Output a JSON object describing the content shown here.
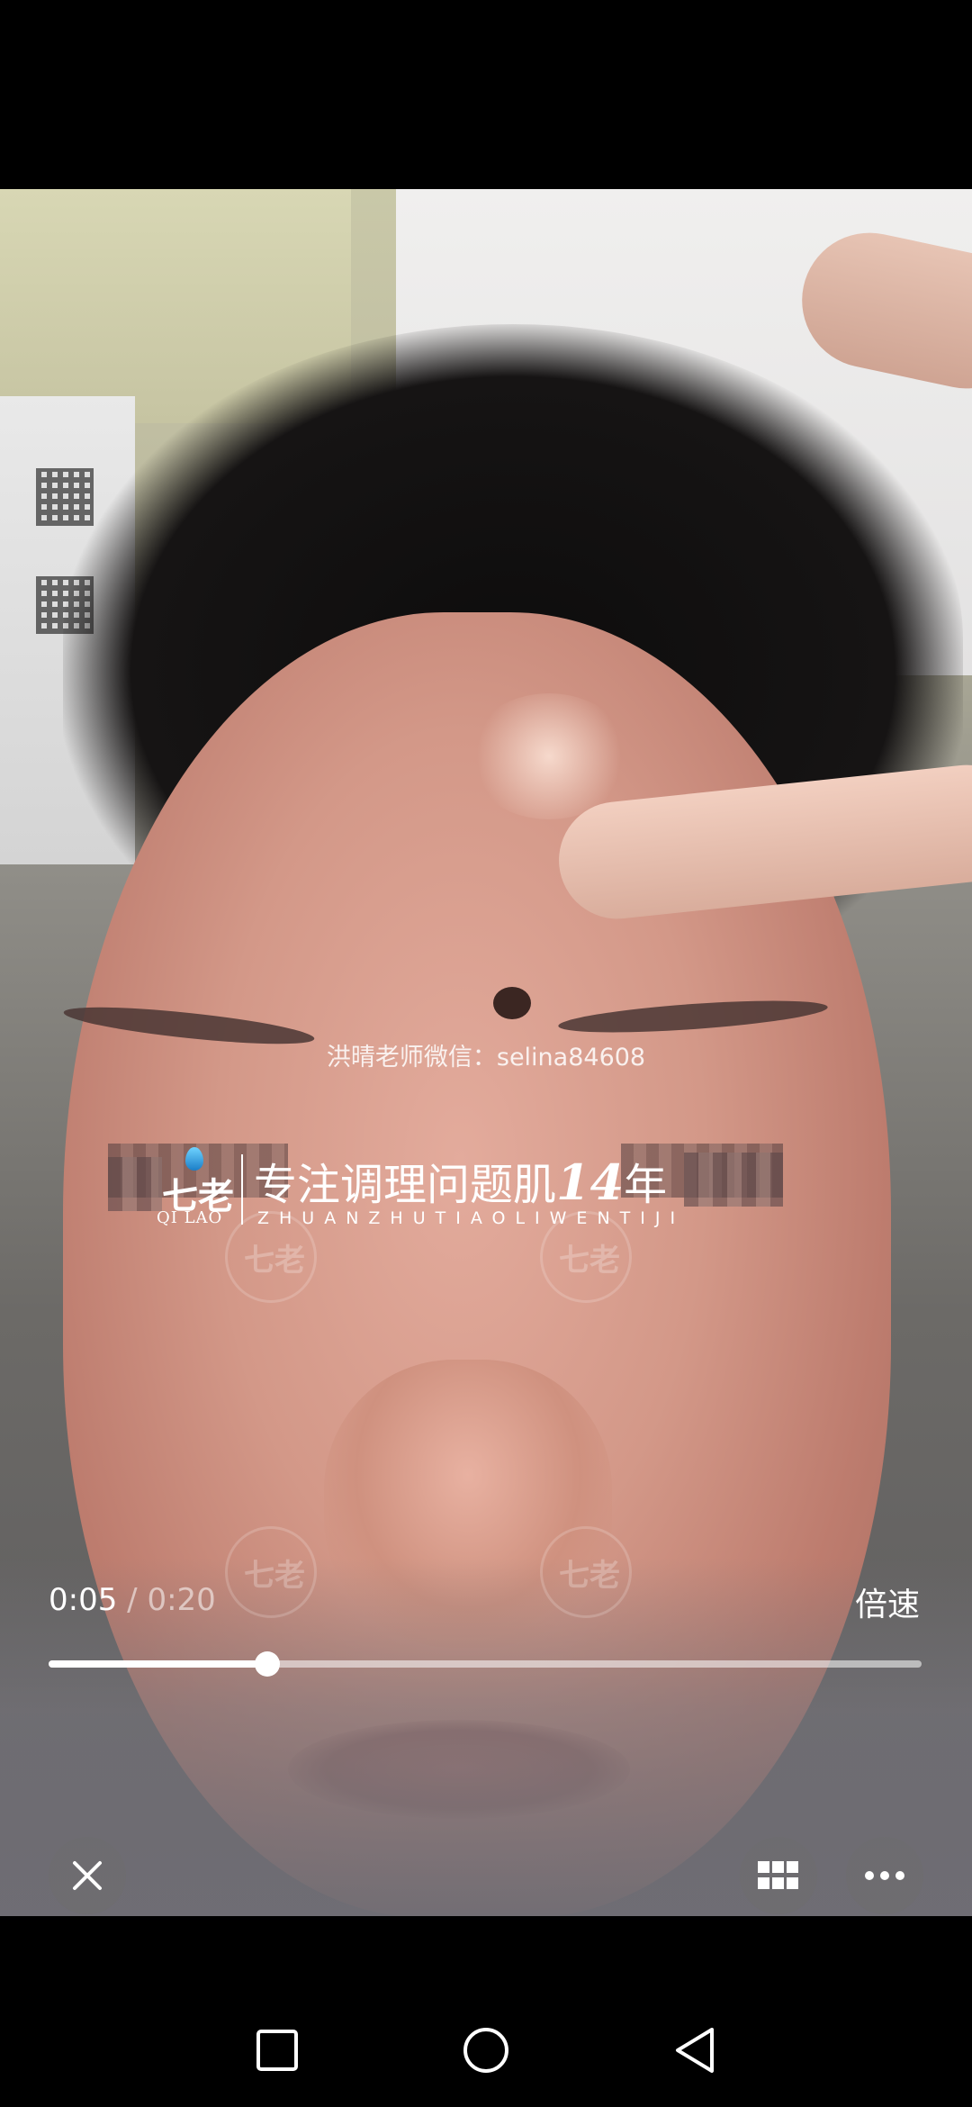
{
  "watermark": {
    "wechat_text": "洪晴老师微信：selina84608",
    "brand_cn": "七老",
    "brand_en": "QI LAO",
    "slogan_main": "专注调理问题肌",
    "slogan_number": "14",
    "slogan_suffix": "年",
    "slogan_pinyin": "ZHUANZHUTIAOLIWENTIJI"
  },
  "player": {
    "current_time": "0:05",
    "separator": "/",
    "total_time": "0:20",
    "progress": 0.25,
    "speed_label": "倍速"
  },
  "icons": {
    "close": "close-icon",
    "grid": "grid-icon",
    "more": "more-dots-icon",
    "nav_recent": "square-recent-apps-icon",
    "nav_home": "circle-home-icon",
    "nav_back": "triangle-back-icon"
  }
}
